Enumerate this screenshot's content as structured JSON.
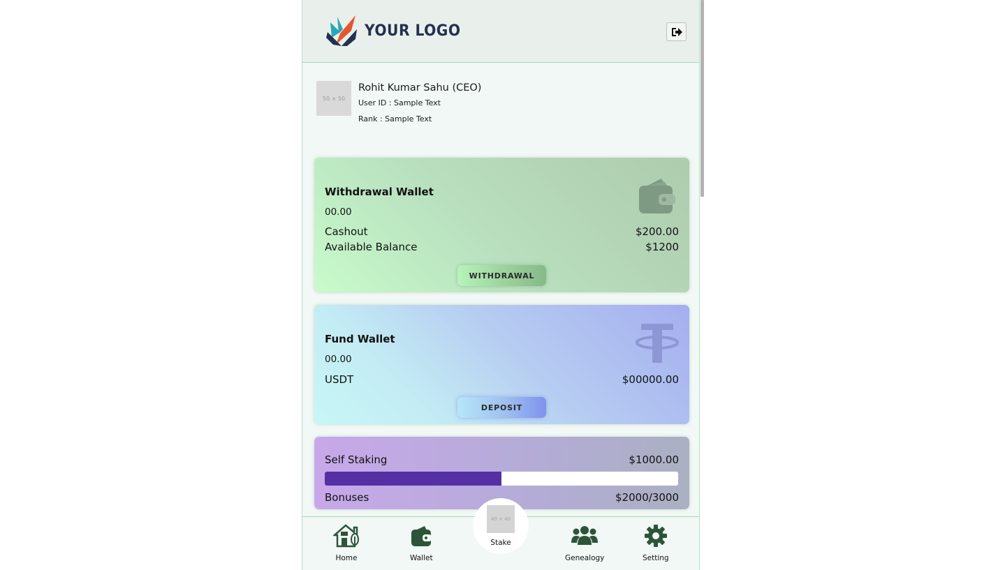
{
  "header": {
    "logo_text": "YOUR LOGO",
    "logout_icon": "sign-out-icon"
  },
  "profile": {
    "avatar_placeholder": "50 × 50",
    "name": "Rohit Kumar Sahu (CEO)",
    "user_id": "User ID : Sample Text",
    "rank": "Rank : Sample Text"
  },
  "withdrawal_wallet": {
    "title": "Withdrawal Wallet",
    "value": "00.00",
    "rows": [
      {
        "label": "Cashout",
        "value": "$200.00"
      },
      {
        "label": "Available Balance",
        "value": "$1200"
      }
    ],
    "button": "WITHDRAWAL",
    "icon": "wallet-icon"
  },
  "fund_wallet": {
    "title": "Fund Wallet",
    "value": "00.00",
    "rows": [
      {
        "label": "USDT",
        "value": "$00000.00"
      }
    ],
    "button": "DEPOSIT",
    "icon": "tether-icon"
  },
  "self_staking": {
    "label": "Self Staking",
    "amount": "$1000.00",
    "progress_fraction": 0.5,
    "bonuses_label": "Bonuses",
    "bonuses_value": "$2000/3000"
  },
  "bottom_nav": {
    "home": "Home",
    "wallet": "Wallet",
    "stake": "Stake",
    "stake_placeholder": "40 × 40",
    "genealogy": "Genealogy",
    "setting": "Setting"
  },
  "colors": {
    "nav_icon": "#2d5438",
    "progress_fill": "#5530a5",
    "accent_border": "#a9d3b4"
  }
}
